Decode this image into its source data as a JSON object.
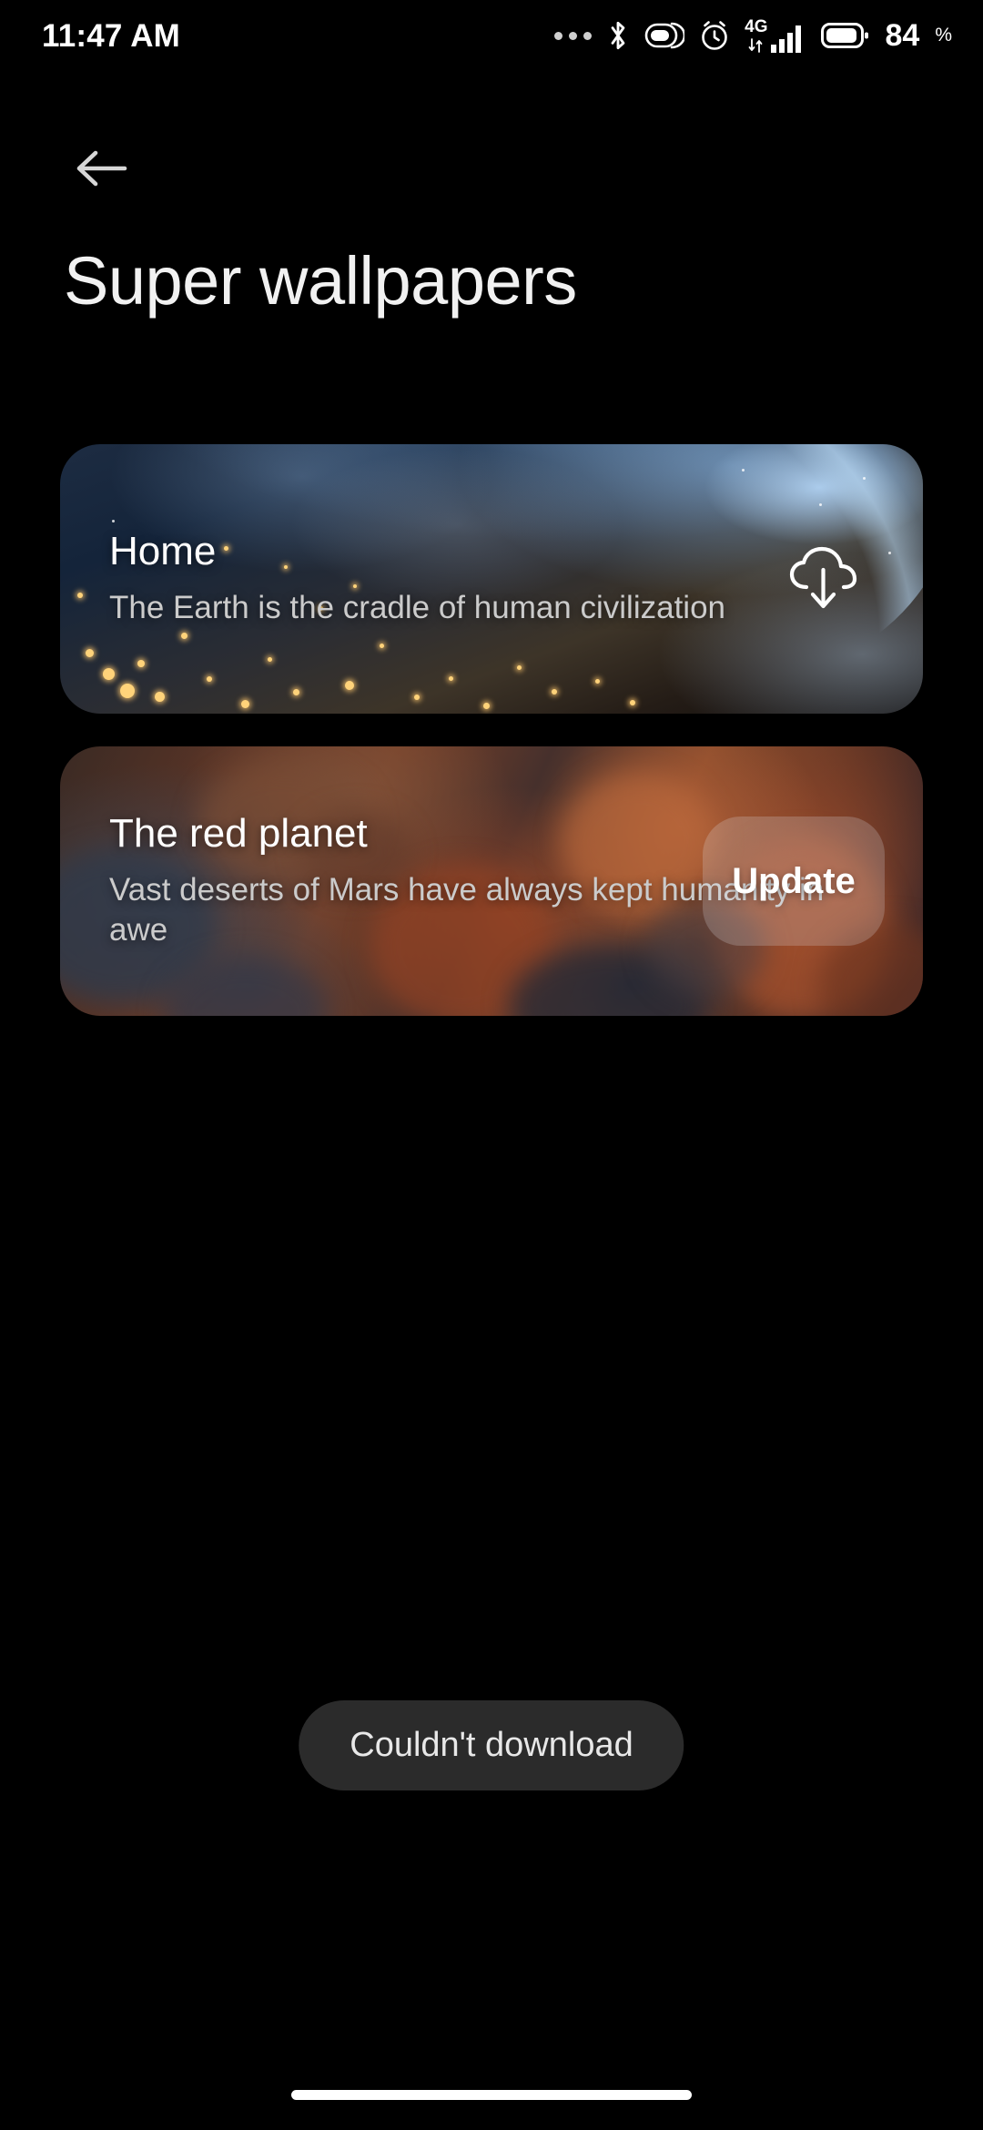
{
  "status_bar": {
    "time": "11:47 AM",
    "battery_percent": "84",
    "percent_sign": "%",
    "network_type": "4G",
    "icons": [
      "more-dots-icon",
      "bluetooth-icon",
      "battery-saver-icon",
      "alarm-clock-icon",
      "mobile-signal-icon",
      "battery-icon"
    ]
  },
  "header": {
    "back_label": "Back",
    "title": "Super wallpapers"
  },
  "wallpapers": [
    {
      "title": "Home",
      "description": "The Earth is the cradle of human civilization",
      "action": "download",
      "action_icon": "cloud-download-icon"
    },
    {
      "title": "The red planet",
      "description": "Vast deserts of Mars have always kept humanity in awe",
      "action": "update",
      "action_label": "Update"
    }
  ],
  "toast": {
    "message": "Couldn't download"
  },
  "nav_bar": {
    "gesture_hint": "Home gesture bar"
  },
  "colors": {
    "background": "#000000",
    "title_text": "#f1f1f1",
    "card_title_text": "#ffffff",
    "card_desc_text": "#cbcbcb",
    "toast_background": "#2b2b2b",
    "toast_text": "#e8e8e8",
    "status_icon": "#ffffff"
  }
}
